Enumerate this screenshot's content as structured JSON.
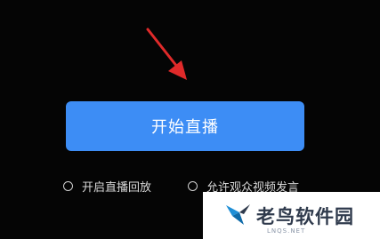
{
  "live": {
    "start_button_label": "开始直播"
  },
  "options": {
    "replay_label": "开启直播回放",
    "replay_checked": false,
    "video_comment_label": "允许观众视频发言",
    "video_comment_checked": false
  },
  "watermark": {
    "title": "老鸟软件园",
    "subtitle": "LNQS.NET"
  },
  "colors": {
    "background": "#050505",
    "button": "#3d8df5",
    "arrow": "#e02a2a"
  },
  "icons": {
    "pointer_arrow": "red-arrow-icon",
    "logo": "bird-logo-icon"
  }
}
